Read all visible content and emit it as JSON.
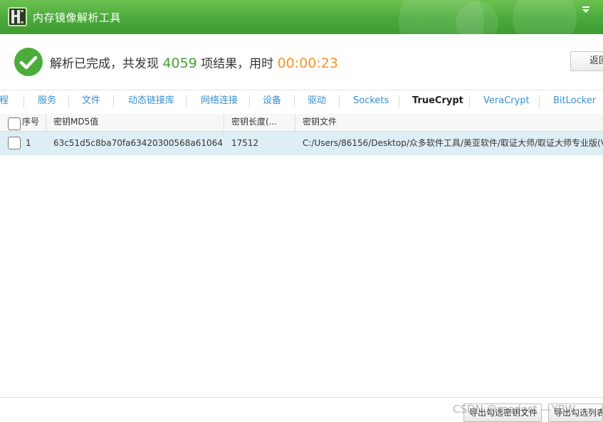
{
  "window": {
    "title": "内存镜像解析工具"
  },
  "status": {
    "prefix": "解析已完成，共发现",
    "count": "4059",
    "middle": "项结果，用时",
    "elapsed": "00:00:23"
  },
  "actions": {
    "back_label": "返回"
  },
  "tabs": [
    {
      "label": "进程",
      "active": false
    },
    {
      "label": "服务",
      "active": false
    },
    {
      "label": "文件",
      "active": false
    },
    {
      "label": "动态链接库",
      "active": false
    },
    {
      "label": "网络连接",
      "active": false
    },
    {
      "label": "设备",
      "active": false
    },
    {
      "label": "驱动",
      "active": false
    },
    {
      "label": "Sockets",
      "active": false
    },
    {
      "label": "TrueCrypt",
      "active": true
    },
    {
      "label": "VeraCrypt",
      "active": false
    },
    {
      "label": "BitLocker",
      "active": false
    }
  ],
  "table": {
    "columns": [
      "序号",
      "密钥MD5值",
      "密钥长度(...",
      "密钥文件"
    ],
    "rows": [
      {
        "index": "1",
        "md5": "63c51d5c8ba70fa63420300568a61064",
        "length": "17512",
        "file": "C:/Users/86156/Desktop/众多软件工具/美亚软件/取证大师/取证大师专业版(V"
      }
    ]
  },
  "footer": {
    "export_selected_keys": "导出勾选密钥文件",
    "export_selected_list": "导出勾选列表",
    "watermark": "CSDN @modest —YBW"
  },
  "colors": {
    "titlebar": "#4aa93b",
    "count": "#43a333",
    "elapsed": "#f0962b",
    "tab_link": "#3a8fd0",
    "row_selected": "#deeef5"
  }
}
